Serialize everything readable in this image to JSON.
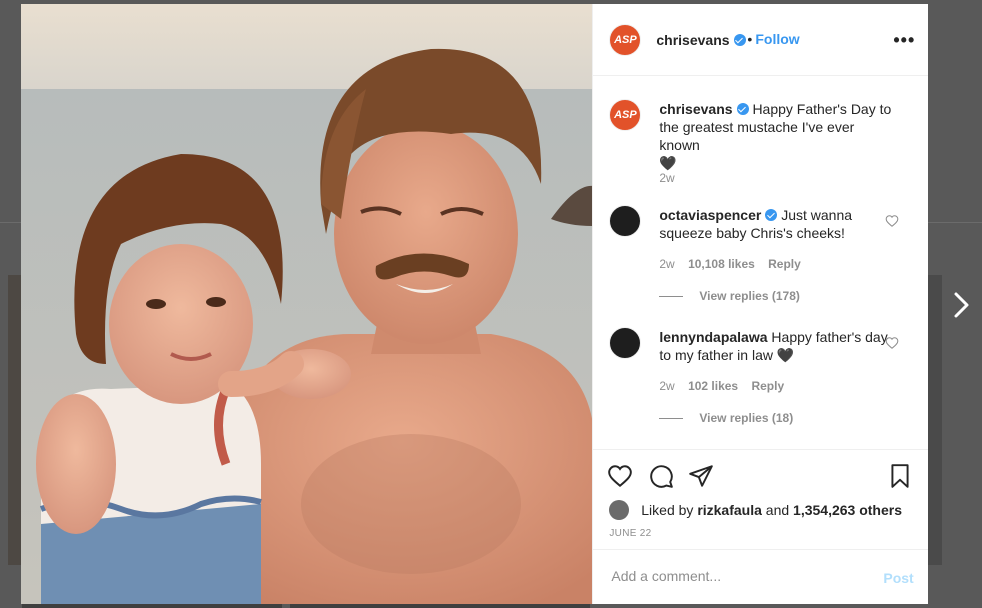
{
  "post": {
    "author": "chrisevans",
    "author_avatar_text": "ASP",
    "follow_label": "Follow",
    "separator": "•",
    "more_label": "•••",
    "caption": "Happy Father's Day to the greatest mustache I've ever known",
    "caption_emoji": "🖤",
    "caption_time": "2w"
  },
  "comments": [
    {
      "username": "octaviaspencer",
      "text": "Just wanna squeeze baby Chris's cheeks!",
      "time": "2w",
      "likes": "10,108 likes",
      "reply_label": "Reply",
      "view_replies": "View replies (178)"
    },
    {
      "username": "lennyndapalawa",
      "text": "Happy father's day to my father in law 🖤",
      "time": "2w",
      "likes": "102 likes",
      "reply_label": "Reply",
      "view_replies": "View replies (18)"
    }
  ],
  "likes": {
    "prefix": "Liked by",
    "user": "rizkafaula",
    "conj": "and",
    "others": "1,354,263 others"
  },
  "date": "JUNE 22",
  "add_comment": {
    "placeholder": "Add a comment...",
    "post_label": "Post"
  },
  "colors": {
    "accent": "#3897f0",
    "post_disabled": "#b2dffc",
    "avatar_brand": "#e2522a"
  },
  "icons": [
    "heart-icon",
    "comment-icon",
    "share-icon",
    "bookmark-icon",
    "verified-icon",
    "more-icon",
    "chevron-right-icon"
  ]
}
